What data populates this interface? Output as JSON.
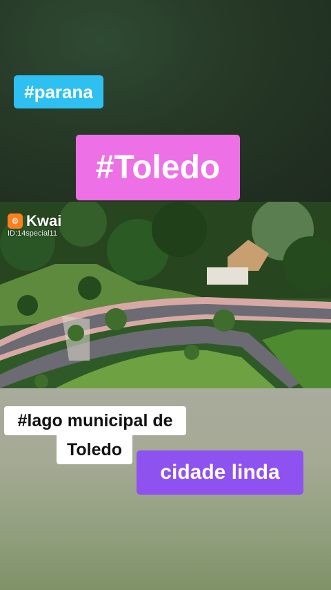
{
  "overlay_tags": {
    "parana": "#parana",
    "toledo": "#Toledo",
    "lago_line1": "#lago municipal de",
    "lago_line2": "Toledo",
    "cidade": "cidade linda"
  },
  "watermark": {
    "logo_glyph": "⚙",
    "brand": "Kwai",
    "user_id": "ID:14special11"
  },
  "colors": {
    "parana_tag": "#2ec0f0",
    "toledo_tag": "#ee70e6",
    "cidade_tag": "#8e52f0",
    "kwai_logo": "#ff7e1f"
  }
}
